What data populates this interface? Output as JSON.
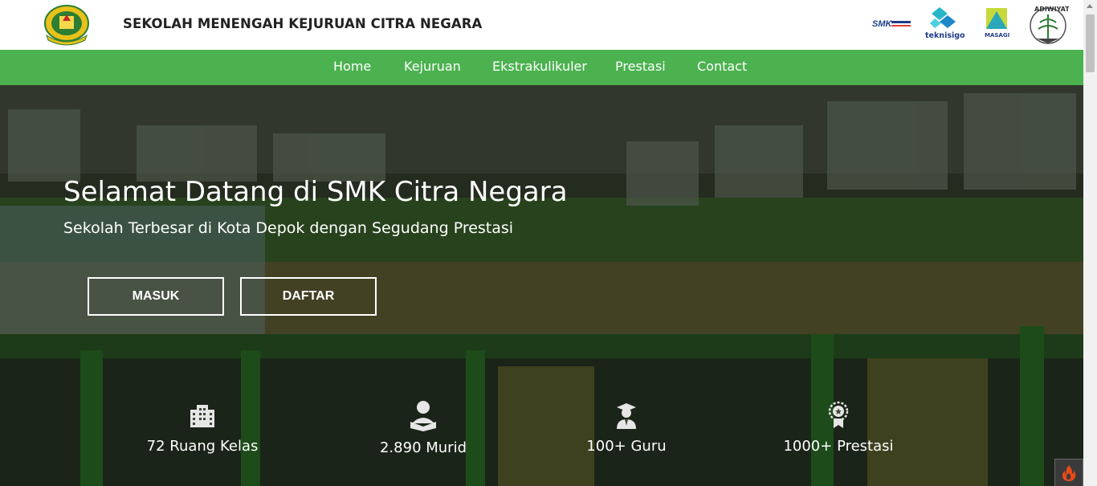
{
  "header": {
    "school_name": "SEKOLAH MENENGAH KEJURUAN CITRA NEGARA",
    "logos": [
      "school-crest-icon",
      "smk-bisa-hebat-logo",
      "teknisigo-logo",
      "masagi-logo",
      "adiwiyata-logo"
    ],
    "partner_labels": {
      "teknisigo": "teknisigo",
      "masagi": "MASAGI",
      "adiwiyata": "ADIWIYATA"
    }
  },
  "nav": {
    "items": [
      {
        "label": "Home"
      },
      {
        "label": "Kejuruan"
      },
      {
        "label": "Ekstrakulikuler"
      },
      {
        "label": "Prestasi"
      },
      {
        "label": "Contact"
      }
    ]
  },
  "hero": {
    "title": "Selamat Datang di SMK Citra Negara",
    "subtitle": "Sekolah Terbesar di Kota Depok dengan Segudang Prestasi",
    "buttons": {
      "masuk": "MASUK",
      "daftar": "DAFTAR"
    }
  },
  "stats": [
    {
      "icon": "building-icon",
      "label": "72 Ruang Kelas"
    },
    {
      "icon": "student-reading-icon",
      "label": "2.890 Murid"
    },
    {
      "icon": "teacher-icon",
      "label": "100+ Guru"
    },
    {
      "icon": "award-medal-icon",
      "label": "1000+ Prestasi"
    }
  ],
  "colors": {
    "nav_green": "#4bb24f",
    "header_text": "#222222",
    "hero_text": "#ffffff"
  }
}
